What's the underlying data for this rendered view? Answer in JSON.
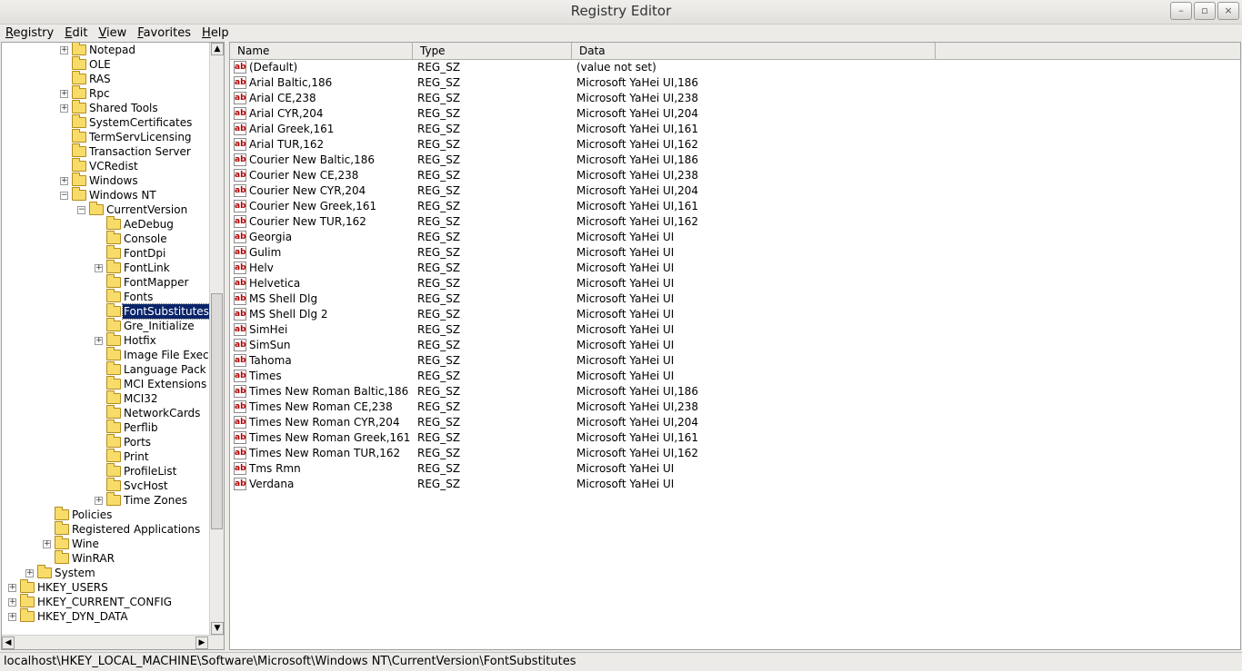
{
  "window": {
    "title": "Registry Editor",
    "minimize_glyph": "–",
    "maximize_glyph": "▫",
    "close_glyph": "×"
  },
  "menu": [
    {
      "key": "R",
      "rest": "egistry"
    },
    {
      "key": "E",
      "rest": "dit"
    },
    {
      "key": "V",
      "rest": "iew"
    },
    {
      "key": "F",
      "rest": "avorites"
    },
    {
      "key": "H",
      "rest": "elp"
    }
  ],
  "tree": [
    {
      "label": "Notepad",
      "level": 2,
      "expander": "+"
    },
    {
      "label": "OLE",
      "level": 2,
      "expander": ""
    },
    {
      "label": "RAS",
      "level": 2,
      "expander": ""
    },
    {
      "label": "Rpc",
      "level": 2,
      "expander": "+"
    },
    {
      "label": "Shared Tools",
      "level": 2,
      "expander": "+"
    },
    {
      "label": "SystemCertificates",
      "level": 2,
      "expander": ""
    },
    {
      "label": "TermServLicensing",
      "level": 2,
      "expander": ""
    },
    {
      "label": "Transaction Server",
      "level": 2,
      "expander": ""
    },
    {
      "label": "VCRedist",
      "level": 2,
      "expander": ""
    },
    {
      "label": "Windows",
      "level": 2,
      "expander": "+"
    },
    {
      "label": "Windows NT",
      "level": 2,
      "expander": "-"
    },
    {
      "label": "CurrentVersion",
      "level": 3,
      "expander": "-"
    },
    {
      "label": "AeDebug",
      "level": 4,
      "expander": ""
    },
    {
      "label": "Console",
      "level": 4,
      "expander": ""
    },
    {
      "label": "FontDpi",
      "level": 4,
      "expander": ""
    },
    {
      "label": "FontLink",
      "level": 4,
      "expander": "+"
    },
    {
      "label": "FontMapper",
      "level": 4,
      "expander": ""
    },
    {
      "label": "Fonts",
      "level": 4,
      "expander": ""
    },
    {
      "label": "FontSubstitutes",
      "level": 4,
      "expander": "",
      "selected": true
    },
    {
      "label": "Gre_Initialize",
      "level": 4,
      "expander": ""
    },
    {
      "label": "Hotfix",
      "level": 4,
      "expander": "+"
    },
    {
      "label": "Image File Execution Options",
      "level": 4,
      "expander": ""
    },
    {
      "label": "Language Pack",
      "level": 4,
      "expander": ""
    },
    {
      "label": "MCI Extensions",
      "level": 4,
      "expander": ""
    },
    {
      "label": "MCI32",
      "level": 4,
      "expander": ""
    },
    {
      "label": "NetworkCards",
      "level": 4,
      "expander": ""
    },
    {
      "label": "Perflib",
      "level": 4,
      "expander": ""
    },
    {
      "label": "Ports",
      "level": 4,
      "expander": ""
    },
    {
      "label": "Print",
      "level": 4,
      "expander": ""
    },
    {
      "label": "ProfileList",
      "level": 4,
      "expander": ""
    },
    {
      "label": "SvcHost",
      "level": 4,
      "expander": ""
    },
    {
      "label": "Time Zones",
      "level": 4,
      "expander": "+"
    },
    {
      "label": "Policies",
      "level": 1,
      "expander": ""
    },
    {
      "label": "Registered Applications",
      "level": 1,
      "expander": ""
    },
    {
      "label": "Wine",
      "level": 1,
      "expander": "+"
    },
    {
      "label": "WinRAR",
      "level": 1,
      "expander": ""
    },
    {
      "label": "System",
      "level": 0,
      "expander": "+"
    },
    {
      "label": "HKEY_USERS",
      "level": -1,
      "expander": "+"
    },
    {
      "label": "HKEY_CURRENT_CONFIG",
      "level": -1,
      "expander": "+"
    },
    {
      "label": "HKEY_DYN_DATA",
      "level": -1,
      "expander": "+"
    }
  ],
  "tree_scroll": {
    "position": 0.72
  },
  "columns": {
    "name": "Name",
    "type": "Type",
    "data": "Data"
  },
  "values": [
    {
      "name": "(Default)",
      "type": "REG_SZ",
      "data": "(value not set)"
    },
    {
      "name": "Arial Baltic,186",
      "type": "REG_SZ",
      "data": "Microsoft YaHei UI,186"
    },
    {
      "name": "Arial CE,238",
      "type": "REG_SZ",
      "data": "Microsoft YaHei UI,238"
    },
    {
      "name": "Arial CYR,204",
      "type": "REG_SZ",
      "data": "Microsoft YaHei UI,204"
    },
    {
      "name": "Arial Greek,161",
      "type": "REG_SZ",
      "data": "Microsoft YaHei UI,161"
    },
    {
      "name": "Arial TUR,162",
      "type": "REG_SZ",
      "data": "Microsoft YaHei UI,162"
    },
    {
      "name": "Courier New Baltic,186",
      "type": "REG_SZ",
      "data": "Microsoft YaHei UI,186"
    },
    {
      "name": "Courier New CE,238",
      "type": "REG_SZ",
      "data": "Microsoft YaHei UI,238"
    },
    {
      "name": "Courier New CYR,204",
      "type": "REG_SZ",
      "data": "Microsoft YaHei UI,204"
    },
    {
      "name": "Courier New Greek,161",
      "type": "REG_SZ",
      "data": "Microsoft YaHei UI,161"
    },
    {
      "name": "Courier New TUR,162",
      "type": "REG_SZ",
      "data": "Microsoft YaHei UI,162"
    },
    {
      "name": "Georgia",
      "type": "REG_SZ",
      "data": "Microsoft YaHei UI"
    },
    {
      "name": "Gulim",
      "type": "REG_SZ",
      "data": "Microsoft YaHei UI"
    },
    {
      "name": "Helv",
      "type": "REG_SZ",
      "data": "Microsoft YaHei UI"
    },
    {
      "name": "Helvetica",
      "type": "REG_SZ",
      "data": "Microsoft YaHei UI"
    },
    {
      "name": "MS Shell Dlg",
      "type": "REG_SZ",
      "data": "Microsoft YaHei UI"
    },
    {
      "name": "MS Shell Dlg 2",
      "type": "REG_SZ",
      "data": "Microsoft YaHei UI"
    },
    {
      "name": "SimHei",
      "type": "REG_SZ",
      "data": "Microsoft YaHei UI"
    },
    {
      "name": "SimSun",
      "type": "REG_SZ",
      "data": "Microsoft YaHei UI"
    },
    {
      "name": "Tahoma",
      "type": "REG_SZ",
      "data": "Microsoft YaHei UI"
    },
    {
      "name": "Times",
      "type": "REG_SZ",
      "data": "Microsoft YaHei UI"
    },
    {
      "name": "Times New Roman Baltic,186",
      "type": "REG_SZ",
      "data": "Microsoft YaHei UI,186"
    },
    {
      "name": "Times New Roman CE,238",
      "type": "REG_SZ",
      "data": "Microsoft YaHei UI,238"
    },
    {
      "name": "Times New Roman CYR,204",
      "type": "REG_SZ",
      "data": "Microsoft YaHei UI,204"
    },
    {
      "name": "Times New Roman Greek,161",
      "type": "REG_SZ",
      "data": "Microsoft YaHei UI,161"
    },
    {
      "name": "Times New Roman TUR,162",
      "type": "REG_SZ",
      "data": "Microsoft YaHei UI,162"
    },
    {
      "name": "Tms Rmn",
      "type": "REG_SZ",
      "data": "Microsoft YaHei UI"
    },
    {
      "name": "Verdana",
      "type": "REG_SZ",
      "data": "Microsoft YaHei UI"
    }
  ],
  "value_icon": {
    "text": "ab",
    "name": "string-value-icon"
  },
  "status": {
    "path": "localhost\\HKEY_LOCAL_MACHINE\\Software\\Microsoft\\Windows NT\\CurrentVersion\\FontSubstitutes"
  }
}
